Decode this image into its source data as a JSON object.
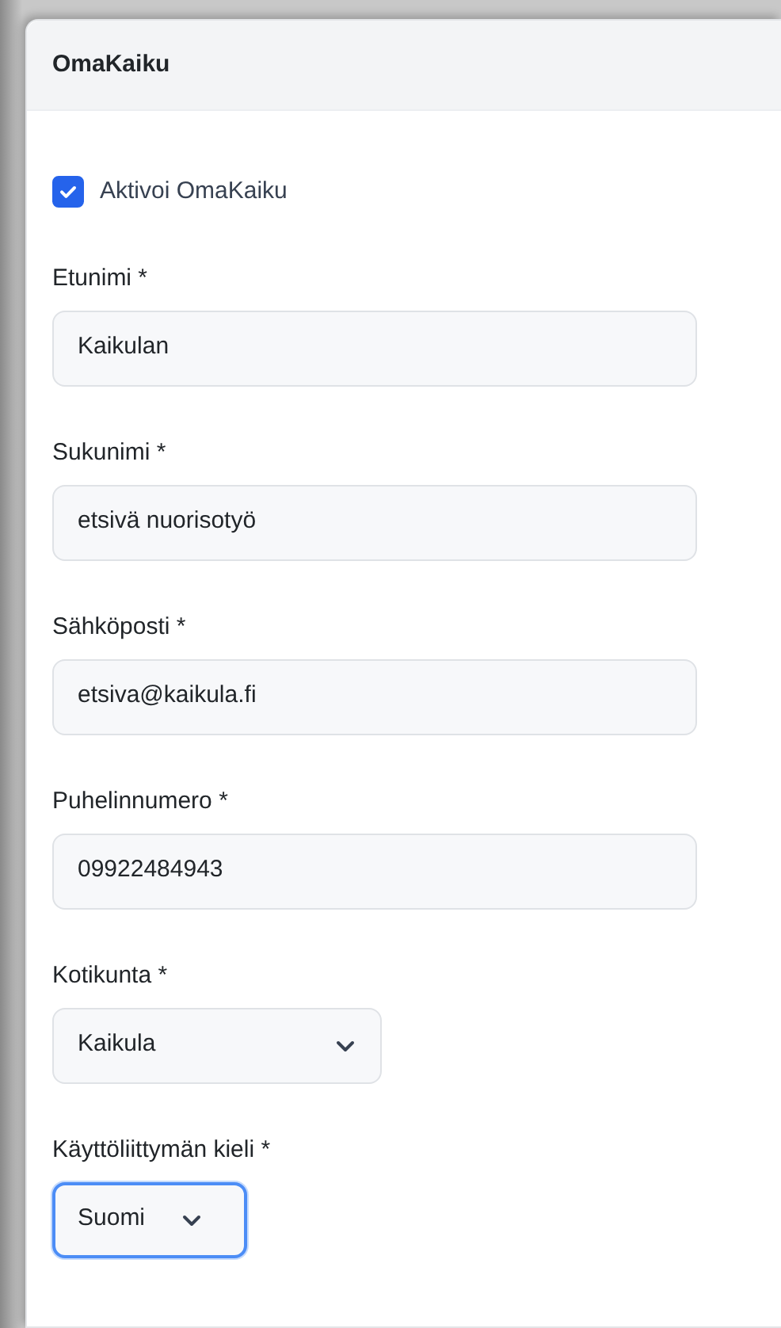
{
  "card": {
    "title": "OmaKaiku"
  },
  "activate": {
    "label": "Aktivoi OmaKaiku",
    "checked": true
  },
  "fields": [
    {
      "kind": "text",
      "label": "Etunimi *",
      "value": "Kaikulan",
      "focused": false
    },
    {
      "kind": "text",
      "label": "Sukunimi *",
      "value": "etsivä nuorisotyö",
      "focused": false
    },
    {
      "kind": "text",
      "label": "Sähköposti *",
      "value": "etsiva@kaikula.fi",
      "focused": false
    },
    {
      "kind": "text",
      "label": "Puhelinnumero *",
      "value": "09922484943",
      "focused": false
    },
    {
      "kind": "select",
      "label": "Kotikunta *",
      "value": "Kaikula",
      "focused": false
    },
    {
      "kind": "select",
      "label": "Käyttöliittymän kieli *",
      "value": "Suomi",
      "focused": true
    }
  ]
}
